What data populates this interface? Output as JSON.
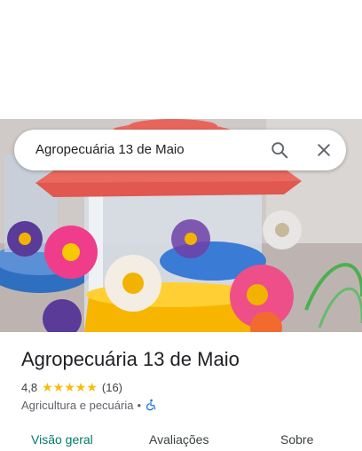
{
  "search": {
    "query": "Agropecuária 13 de Maio"
  },
  "place": {
    "name": "Agropecuária 13 de Maio",
    "rating": "4,8",
    "stars": 5,
    "review_count": "(16)",
    "category": "Agricultura e pecuária",
    "separator": "•"
  },
  "tabs": [
    {
      "label": "Visão geral",
      "active": true
    },
    {
      "label": "Avaliações",
      "active": false
    },
    {
      "label": "Sobre",
      "active": false
    }
  ],
  "colors": {
    "accent": "#00796b",
    "star": "#fbbc04",
    "accessibility_icon": "#1a73e8"
  },
  "icons": {
    "search": "search-icon",
    "close": "close-icon",
    "accessibility": "wheelchair-icon"
  }
}
